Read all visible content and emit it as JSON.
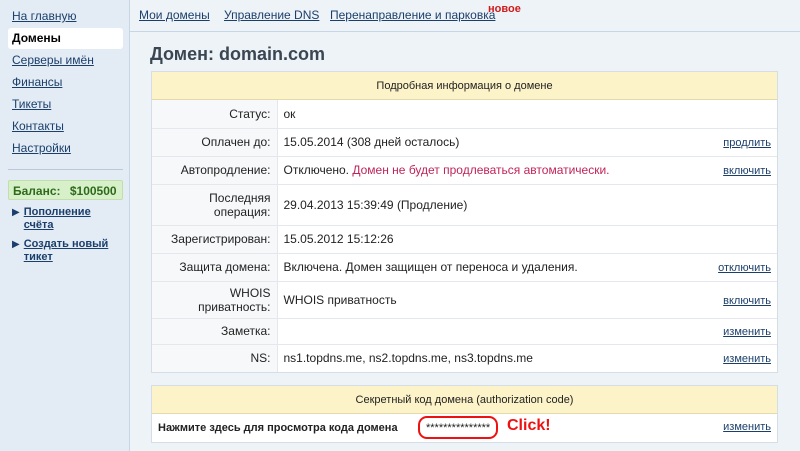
{
  "sidebar": {
    "items": [
      {
        "label": "На главную"
      },
      {
        "label": "Домены"
      },
      {
        "label": "Серверы имён"
      },
      {
        "label": "Финансы"
      },
      {
        "label": "Тикеты"
      },
      {
        "label": "Контакты"
      },
      {
        "label": "Настройки"
      }
    ],
    "active": "Домены",
    "balance_label": "Баланс:",
    "balance_value": "$100500",
    "actions": [
      {
        "label": "Пополнение счёта"
      },
      {
        "label": "Создать новый тикет"
      }
    ]
  },
  "topnav": {
    "links": [
      {
        "label": "Мои домены"
      },
      {
        "label": "Управление DNS"
      },
      {
        "label": "Перенаправление и парковка"
      }
    ],
    "badge": "новое"
  },
  "page": {
    "title": "Домен: domain.com"
  },
  "info_panel": {
    "header": "Подробная информация о домене",
    "rows": [
      {
        "label": "Статус:",
        "value": "ок",
        "action": ""
      },
      {
        "label": "Оплачен до:",
        "value": "15.05.2014 (308 дней осталось)",
        "action": "продлить"
      },
      {
        "label": "Автопродление:",
        "value": "Отключено.",
        "value_warning": "Домен не будет продлеваться автоматически.",
        "action": "включить"
      },
      {
        "label": "Последняя операция:",
        "value": "29.04.2013 15:39:49 (Продление)",
        "action": ""
      },
      {
        "label": "Зарегистрирован:",
        "value": "15.05.2012 15:12:26",
        "action": ""
      },
      {
        "label": "Защита домена:",
        "value": "Включена. Домен защищен от переноса и удаления.",
        "action": "отключить"
      },
      {
        "label": "WHOIS приватность:",
        "value": "WHOIS приватность",
        "action": "включить"
      },
      {
        "label": "Заметка:",
        "value": "",
        "action": "изменить"
      },
      {
        "label": "NS:",
        "value": "ns1.topdns.me, ns2.topdns.me, ns3.topdns.me",
        "action": "изменить"
      }
    ]
  },
  "auth_panel": {
    "header": "Секретный код домена (authorization code)",
    "label": "Нажмите здесь для просмотра кода домена",
    "code_masked": "***************",
    "annotation": "Click!",
    "action": "изменить"
  },
  "colors": {
    "link": "#1b3f6b",
    "warning": "#c0245a",
    "highlight": "#e11111",
    "panel_header_bg": "#fdf3c9",
    "balance_bg": "#d7f0c9"
  }
}
